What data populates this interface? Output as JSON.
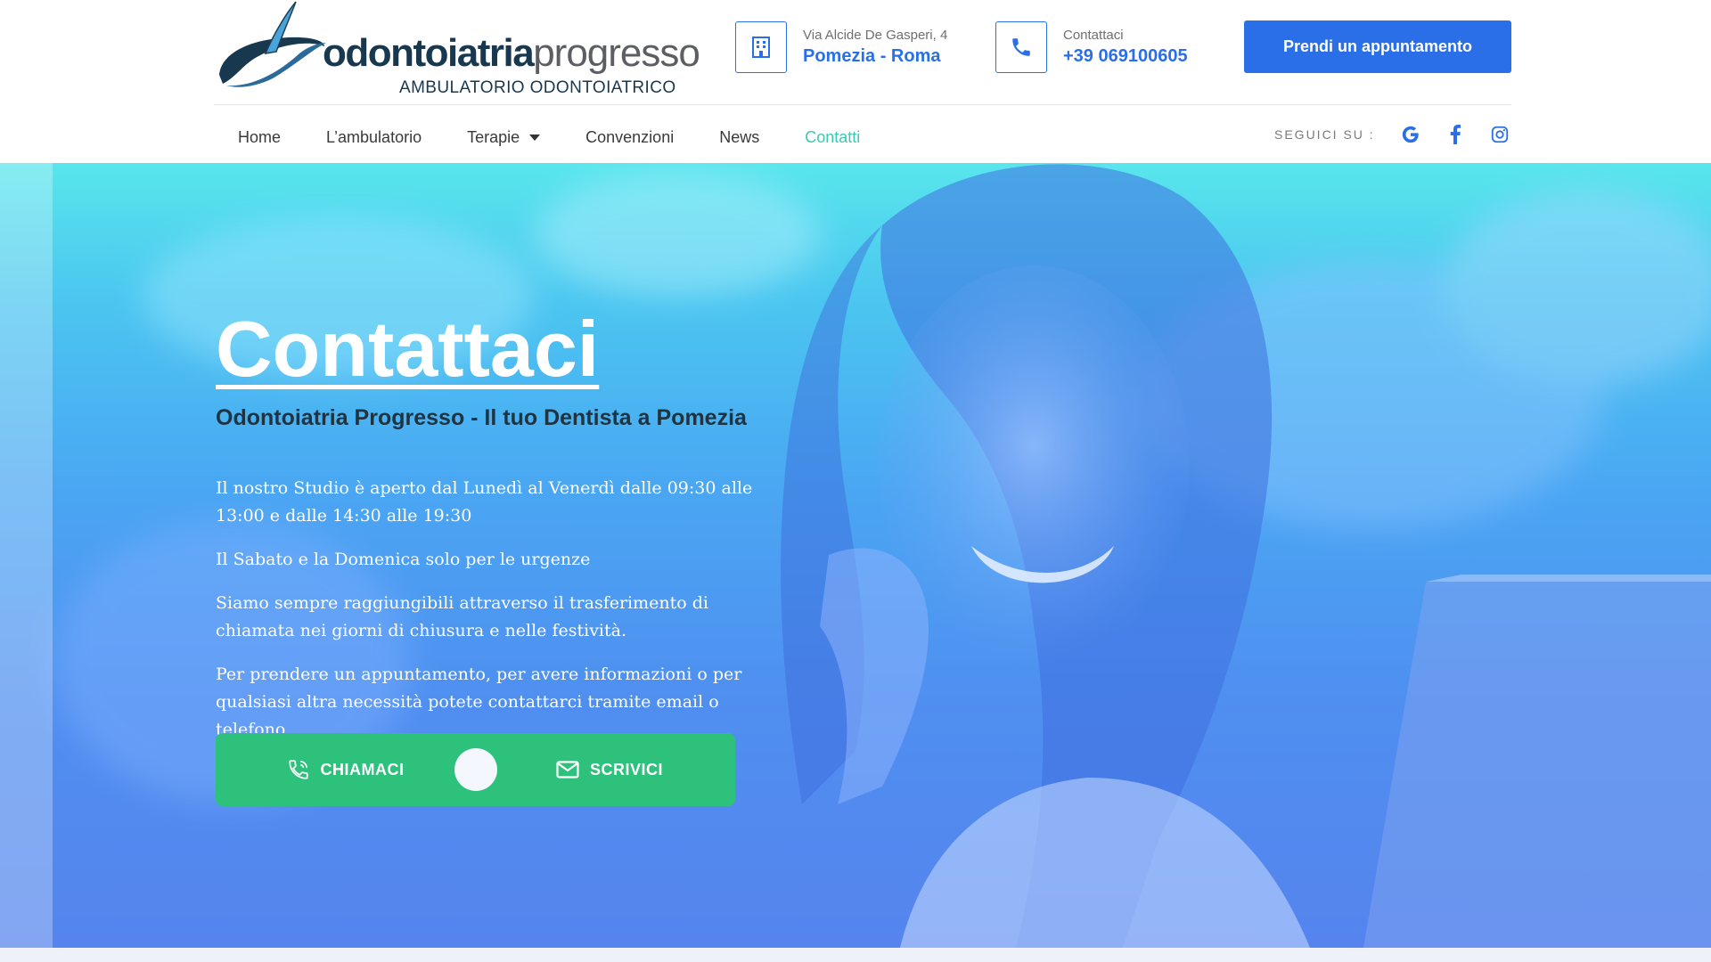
{
  "header": {
    "logo": {
      "brand_bold": "odontoiatria",
      "brand_light": "progresso",
      "subtitle": "AMBULATORIO ODONTOIATRICO"
    },
    "address": {
      "small": "Via Alcide De Gasperi, 4",
      "big": "Pomezia - Roma",
      "icon": "building-icon"
    },
    "contact": {
      "small": "Contattaci",
      "big": "+39 069100605",
      "icon": "phone-icon"
    },
    "cta_label": "Prendi un appuntamento",
    "accent_color": "#2a6fe8"
  },
  "nav": {
    "items": [
      {
        "label": "Home"
      },
      {
        "label": "L’ambulatorio"
      },
      {
        "label": "Terapie"
      },
      {
        "label": "Convenzioni"
      },
      {
        "label": "News"
      },
      {
        "label": "Contatti"
      }
    ],
    "active": "Contatti",
    "active_color": "#3cc7b4"
  },
  "social": {
    "label": "SEGUICI SU :",
    "icons": [
      "google-icon",
      "facebook-icon",
      "instagram-icon"
    ]
  },
  "hero": {
    "title": "Contattaci",
    "subtitle": "Odontoiatria Progresso - Il tuo Dentista a Pomezia",
    "paragraphs": [
      "Il nostro Studio è aperto dal Lunedì al Venerdì dalle 09:30 alle 13:00 e dalle 14:30 alle 19:30",
      "Il Sabato e la Domenica solo per le urgenze",
      "Siamo sempre raggiungibili attraverso il trasferimento di chiamata nei giorni di chiusura e nelle festività.",
      "Per prendere un appuntamento, per avere informazioni o per qualsiasi altra necessità potete contattarci tramite email o telefono"
    ],
    "buttons": {
      "call": "CHIAMACI",
      "write": "SCRIVICI"
    },
    "button_color": "#2dc17c"
  }
}
